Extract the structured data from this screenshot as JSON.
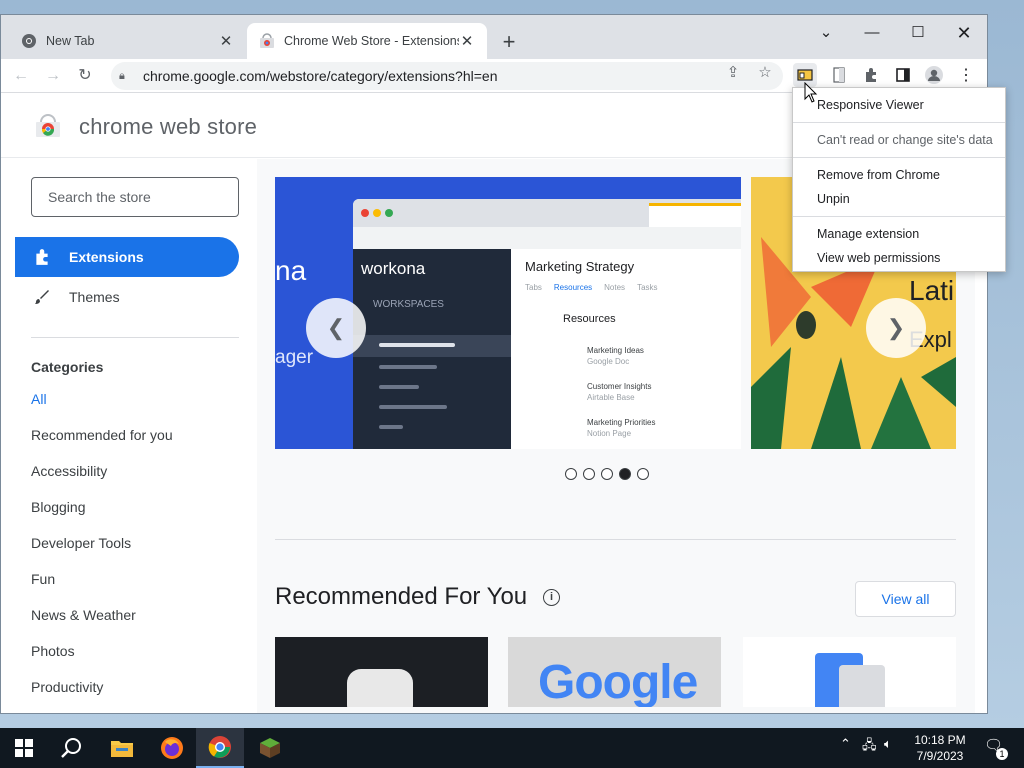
{
  "tabs": [
    {
      "title": "New Tab"
    },
    {
      "title": "Chrome Web Store - Extensions"
    }
  ],
  "address": {
    "url": "chrome.google.com/webstore/category/extensions?hl=en"
  },
  "store": {
    "brand": "chrome web store",
    "search_placeholder": "Search the store"
  },
  "sidebar": {
    "nav": [
      {
        "label": "Extensions"
      },
      {
        "label": "Themes"
      }
    ],
    "categories_heading": "Categories",
    "categories": [
      "All",
      "Recommended for you",
      "Accessibility",
      "Blogging",
      "Developer Tools",
      "Fun",
      "News & Weather",
      "Photos",
      "Productivity"
    ]
  },
  "carousel": {
    "slide1": {
      "brand_fragment": "na",
      "fragment2": "ager",
      "app_name": "workona",
      "panel_title": "Marketing Strategy",
      "workspaces_label": "WORKSPACES",
      "tabs": [
        "Tabs",
        "Resources",
        "Notes",
        "Tasks"
      ],
      "resources_label": "Resources",
      "items": [
        {
          "title": "Marketing Ideas",
          "sub": "Google Doc"
        },
        {
          "title": "Customer Insights",
          "sub": "Airtable Base"
        },
        {
          "title": "Marketing Priorities",
          "sub": "Notion Page"
        }
      ]
    },
    "slide2": {
      "text1": "Latin",
      "text2": "Expl"
    },
    "active_dot": 3,
    "dot_count": 5
  },
  "recommended": {
    "heading": "Recommended For You",
    "view_all": "View all",
    "google_text": "Google"
  },
  "context_menu": {
    "title": "Responsive Viewer",
    "site_data": "Can't read or change site's data",
    "remove": "Remove from Chrome",
    "unpin": "Unpin",
    "manage": "Manage extension",
    "permissions": "View web permissions"
  },
  "taskbar": {
    "time": "10:18 PM",
    "date": "7/9/2023",
    "notification_count": "1"
  },
  "colors": {
    "accent": "#1a73e8",
    "taskbar": "#101820",
    "tabstrip": "#dee1e6"
  }
}
